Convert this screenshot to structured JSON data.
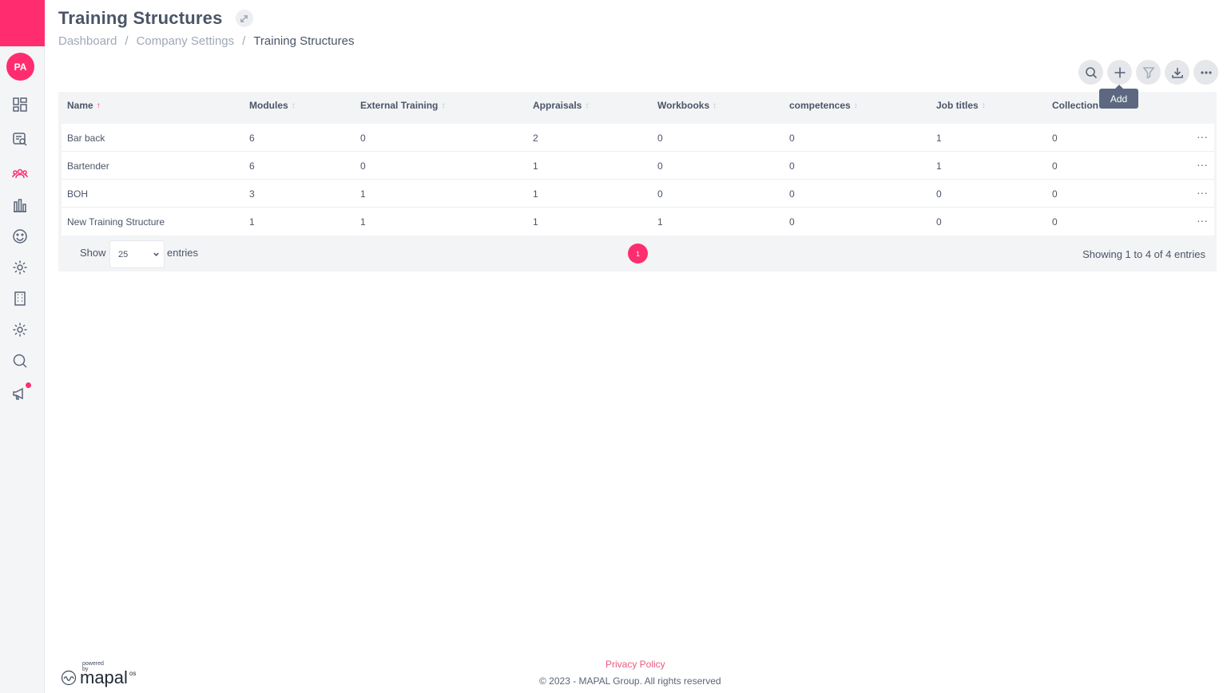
{
  "sidebar": {
    "avatar_initials": "PA",
    "icons": [
      "dashboard-icon",
      "search-list-icon",
      "people-icon",
      "bar-chart-icon",
      "smiley-icon",
      "settings-icon",
      "building-icon",
      "settings-alt-icon",
      "search-icon",
      "megaphone-icon"
    ]
  },
  "header": {
    "title": "Training Structures",
    "breadcrumb": [
      "Dashboard",
      "Company Settings",
      "Training Structures"
    ],
    "separator": "/"
  },
  "actions": {
    "buttons": [
      "search-icon",
      "plus-icon",
      "filter-icon",
      "download-icon",
      "more-icon"
    ],
    "tooltip": "Add"
  },
  "table": {
    "columns": [
      "Name",
      "Modules",
      "External Training",
      "Appraisals",
      "Workbooks",
      "competences",
      "Job titles",
      "Collection"
    ],
    "rows": [
      [
        "Bar back",
        "6",
        "0",
        "2",
        "0",
        "0",
        "1",
        "0"
      ],
      [
        "Bartender",
        "6",
        "0",
        "1",
        "0",
        "0",
        "1",
        "0"
      ],
      [
        "BOH",
        "3",
        "1",
        "1",
        "0",
        "0",
        "0",
        "0"
      ],
      [
        "New Training Structure",
        "1",
        "1",
        "1",
        "1",
        "0",
        "0",
        "0"
      ]
    ],
    "show_label": "Show",
    "entries_value": "25",
    "entries_label": "entries",
    "current_page": "1",
    "summary": "Showing 1 to 4 of 4 entries"
  },
  "footer": {
    "privacy": "Privacy Policy",
    "copyright": "© 2023 - MAPAL Group. All rights reserved",
    "powered_by": "powered by",
    "logo": "mapal",
    "logo_suffix": "os"
  },
  "colors": {
    "accent": "#ff2d6f",
    "text": "#4a5568",
    "muted": "#a0a9b6"
  }
}
